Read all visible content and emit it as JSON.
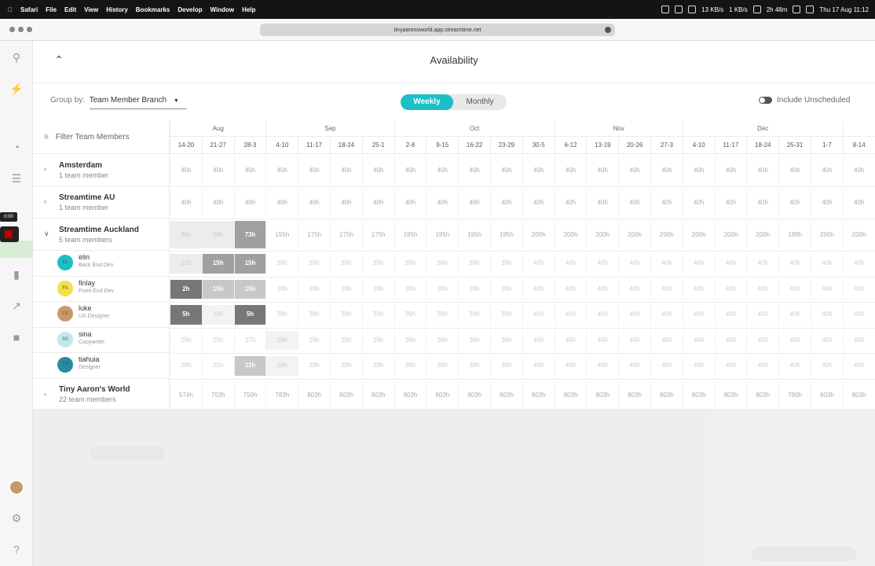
{
  "menubar": {
    "items": [
      "Safari",
      "File",
      "Edit",
      "View",
      "History",
      "Bookmarks",
      "Develop",
      "Window",
      "Help"
    ],
    "status": {
      "net_up": "13 KB/s",
      "net_down": "1 KB/s",
      "battery_time": "2h 48m",
      "clock": "Thu 17 Aug  11:12"
    }
  },
  "browser": {
    "url": "tinyaaronsworld.app.streamtime.net"
  },
  "sidebar": {
    "timer": "0:00"
  },
  "page": {
    "title": "Availability"
  },
  "controls": {
    "group_by_label": "Group by:",
    "group_by_value": "Team Member Branch",
    "view_weekly": "Weekly",
    "view_monthly": "Monthly",
    "include_unscheduled": "Include Unscheduled"
  },
  "grid": {
    "filter_label": "Filter Team Members",
    "months": [
      {
        "label": "Aug",
        "span": 3
      },
      {
        "label": "Sep",
        "span": 4
      },
      {
        "label": "Oct",
        "span": 5
      },
      {
        "label": "Nov",
        "span": 4
      },
      {
        "label": "Dec",
        "span": 5
      },
      {
        "label": "",
        "span": 2
      }
    ],
    "weeks": [
      "14-20",
      "21-27",
      "28-3",
      "4-10",
      "11-17",
      "18-24",
      "25-1",
      "2-8",
      "9-15",
      "16-22",
      "23-29",
      "30-5",
      "6-12",
      "13-19",
      "20-26",
      "27-3",
      "4-10",
      "11-17",
      "18-24",
      "25-31",
      "1-7",
      "8-14"
    ],
    "rows": [
      {
        "type": "branch",
        "name": "Amsterdam",
        "sub": "1 team member",
        "expanded": false,
        "values": [
          "40h",
          "40h",
          "40h",
          "40h",
          "40h",
          "40h",
          "40h",
          "40h",
          "40h",
          "40h",
          "40h",
          "40h",
          "40h",
          "40h",
          "40h",
          "40h",
          "40h",
          "40h",
          "40h",
          "40h",
          "40h",
          "40h"
        ],
        "levels": [
          0,
          0,
          0,
          0,
          0,
          0,
          0,
          0,
          0,
          0,
          0,
          0,
          0,
          0,
          0,
          0,
          0,
          0,
          0,
          0,
          0,
          0
        ]
      },
      {
        "type": "branch",
        "name": "Streamtime AU",
        "sub": "1 team member",
        "expanded": false,
        "values": [
          "40h",
          "40h",
          "40h",
          "40h",
          "40h",
          "40h",
          "40h",
          "40h",
          "40h",
          "40h",
          "40h",
          "40h",
          "40h",
          "40h",
          "40h",
          "40h",
          "40h",
          "40h",
          "40h",
          "40h",
          "40h",
          "40h"
        ],
        "levels": [
          0,
          0,
          0,
          0,
          0,
          0,
          0,
          0,
          0,
          0,
          0,
          0,
          0,
          0,
          0,
          0,
          0,
          0,
          0,
          0,
          0,
          0
        ]
      },
      {
        "type": "branch",
        "name": "Streamtime Auckland",
        "sub": "5 team members",
        "expanded": true,
        "values": [
          "86h",
          "98h",
          "73h",
          "155h",
          "175h",
          "175h",
          "175h",
          "195h",
          "195h",
          "195h",
          "195h",
          "200h",
          "200h",
          "200h",
          "200h",
          "200h",
          "200h",
          "200h",
          "200h",
          "199h",
          "200h",
          "200h"
        ],
        "levels": [
          1,
          1,
          3,
          0,
          0,
          0,
          0,
          0,
          0,
          0,
          0,
          0,
          0,
          0,
          0,
          0,
          0,
          0,
          0,
          0,
          0,
          0
        ]
      },
      {
        "type": "member",
        "name": "elin",
        "role": "Back End Dev",
        "initials": "EL",
        "avatar_color": "#1bbfc5",
        "values": [
          "21h",
          "15h",
          "15h",
          "39h",
          "39h",
          "39h",
          "39h",
          "39h",
          "39h",
          "39h",
          "39h",
          "40h",
          "40h",
          "40h",
          "40h",
          "40h",
          "40h",
          "40h",
          "40h",
          "40h",
          "40h",
          "40h"
        ],
        "levels": [
          1,
          3,
          3,
          0,
          0,
          0,
          0,
          0,
          0,
          0,
          0,
          0,
          0,
          0,
          0,
          0,
          0,
          0,
          0,
          0,
          0,
          0
        ]
      },
      {
        "type": "member",
        "name": "finlay",
        "role": "Front End Dev",
        "initials": "FA",
        "avatar_color": "#f5e04a",
        "values": [
          "2h",
          "15h",
          "15h",
          "39h",
          "39h",
          "39h",
          "39h",
          "39h",
          "39h",
          "39h",
          "39h",
          "40h",
          "40h",
          "40h",
          "40h",
          "40h",
          "40h",
          "40h",
          "40h",
          "40h",
          "40h",
          "40h"
        ],
        "levels": [
          4,
          2,
          2,
          0,
          0,
          0,
          0,
          0,
          0,
          0,
          0,
          0,
          0,
          0,
          0,
          0,
          0,
          0,
          0,
          0,
          0,
          0
        ]
      },
      {
        "type": "member",
        "name": "luke",
        "role": "UX Designer",
        "initials": "LU",
        "avatar_color": "#c89a6a",
        "values": [
          "5h",
          "18h",
          "5h",
          "39h",
          "39h",
          "39h",
          "39h",
          "39h",
          "39h",
          "39h",
          "39h",
          "40h",
          "40h",
          "40h",
          "40h",
          "40h",
          "40h",
          "40h",
          "40h",
          "40h",
          "40h",
          "40h"
        ],
        "levels": [
          4,
          5,
          4,
          0,
          0,
          0,
          0,
          0,
          0,
          0,
          0,
          0,
          0,
          0,
          0,
          0,
          0,
          0,
          0,
          0,
          0,
          0
        ]
      },
      {
        "type": "member",
        "name": "sina",
        "role": "Copywriter",
        "initials": "SS",
        "avatar_color": "#bfe9ec",
        "values": [
          "29h",
          "25h",
          "27h",
          "19h",
          "29h",
          "29h",
          "29h",
          "39h",
          "39h",
          "39h",
          "39h",
          "40h",
          "40h",
          "40h",
          "40h",
          "40h",
          "40h",
          "40h",
          "40h",
          "40h",
          "40h",
          "40h"
        ],
        "levels": [
          0,
          0,
          0,
          5,
          0,
          0,
          0,
          0,
          0,
          0,
          0,
          0,
          0,
          0,
          0,
          0,
          0,
          0,
          0,
          0,
          0,
          0
        ]
      },
      {
        "type": "member",
        "name": "tiahuia",
        "role": "Designer",
        "initials": "TR",
        "avatar_color": "#2a8aa0",
        "values": [
          "29h",
          "25h",
          "11h",
          "19h",
          "29h",
          "29h",
          "29h",
          "39h",
          "39h",
          "39h",
          "39h",
          "40h",
          "40h",
          "40h",
          "40h",
          "40h",
          "40h",
          "40h",
          "40h",
          "40h",
          "40h",
          "40h"
        ],
        "levels": [
          0,
          0,
          2,
          5,
          0,
          0,
          0,
          0,
          0,
          0,
          0,
          0,
          0,
          0,
          0,
          0,
          0,
          0,
          0,
          0,
          0,
          0
        ]
      },
      {
        "type": "branch",
        "name": "Tiny Aaron's World",
        "sub": "22 team members",
        "expanded": false,
        "values": [
          "574h",
          "703h",
          "750h",
          "783h",
          "803h",
          "803h",
          "803h",
          "803h",
          "803h",
          "803h",
          "803h",
          "803h",
          "803h",
          "803h",
          "803h",
          "803h",
          "803h",
          "803h",
          "803h",
          "790h",
          "803h",
          "803h"
        ],
        "levels": [
          0,
          0,
          0,
          0,
          0,
          0,
          0,
          0,
          0,
          0,
          0,
          0,
          0,
          0,
          0,
          0,
          0,
          0,
          0,
          0,
          0,
          0
        ]
      }
    ]
  }
}
